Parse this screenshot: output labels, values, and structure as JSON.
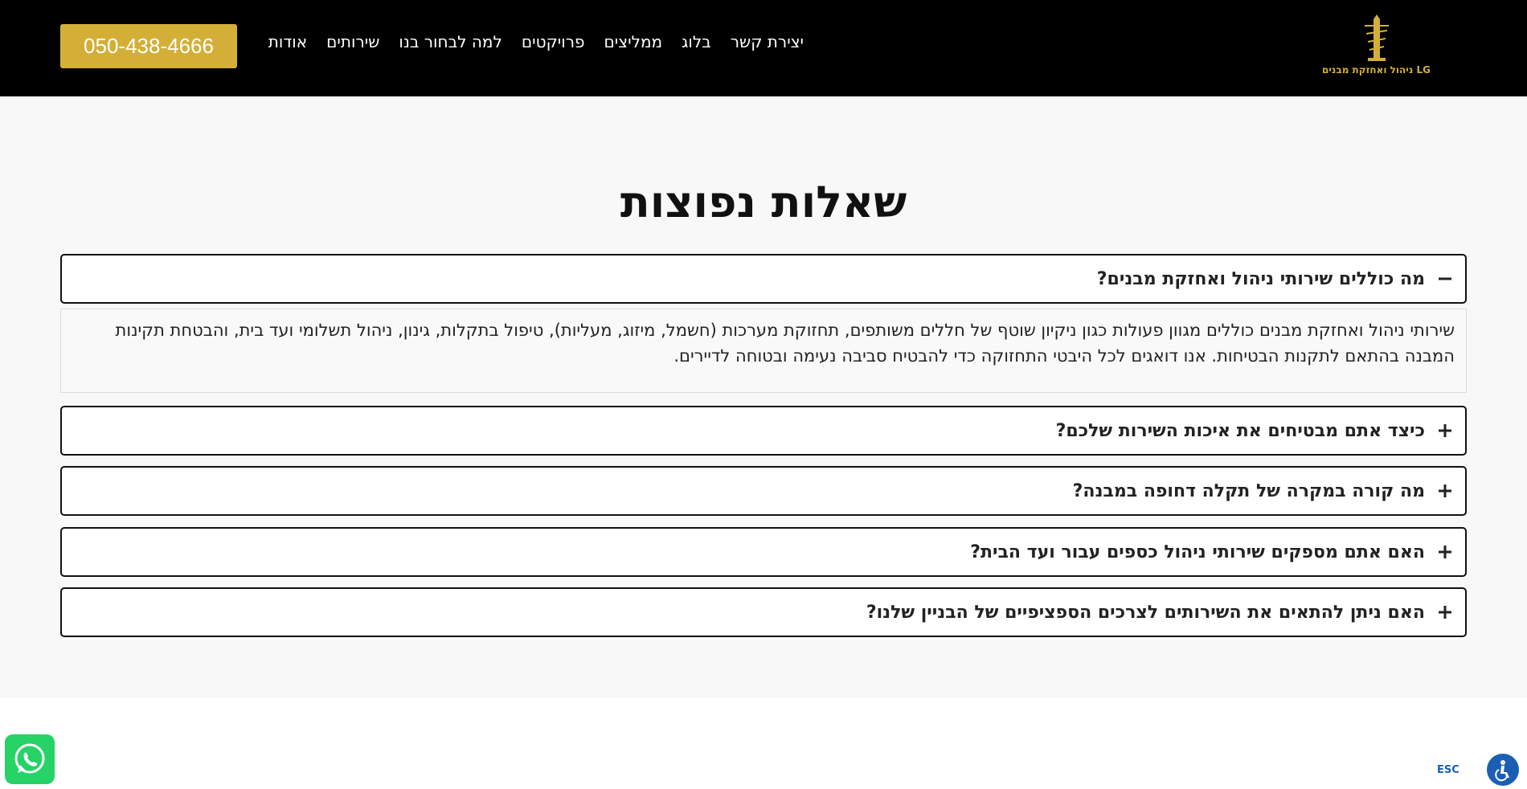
{
  "header": {
    "phone": "050-438-4666",
    "nav": [
      "אודות",
      "שירותים",
      "למה לבחור בנו",
      "פרויקטים",
      "ממליצים",
      "בלוג",
      "יצירת קשר"
    ],
    "logo_text": "LG ניהול ואחזקת מבנים"
  },
  "main": {
    "title": "שאלות נפוצות",
    "faqs": [
      {
        "question": "מה כוללים שירותי ניהול ואחזקת מבנים?",
        "expanded": true,
        "answer": "שירותי ניהול ואחזקת מבנים כוללים מגוון פעולות כגון ניקיון שוטף של חללים משותפים, תחזוקת מערכות (חשמל, מיזוג, מעליות), טיפול בתקלות, גינון, ניהול תשלומי ועד בית, והבטחת תקינות המבנה בהתאם לתקנות הבטיחות. אנו דואגים לכל היבטי התחזוקה כדי להבטיח סביבה נעימה ובטוחה לדיירים."
      },
      {
        "question": "כיצד אתם מבטיחים את איכות השירות שלכם?",
        "expanded": false
      },
      {
        "question": "מה קורה במקרה של תקלה דחופה במבנה?",
        "expanded": false
      },
      {
        "question": "האם אתם מספקים שירותי ניהול כספים עבור ועד הבית?",
        "expanded": false
      },
      {
        "question": "האם ניתן להתאים את השירותים לצרכים הספציפיים של הבניין שלנו?",
        "expanded": false
      }
    ]
  },
  "footer": {
    "esc_label": "ESC"
  },
  "colors": {
    "header_bg": "#000000",
    "accent_gold": "#d4af37",
    "whatsapp_green": "#25d366",
    "accessibility_blue": "#1a5fb4"
  }
}
